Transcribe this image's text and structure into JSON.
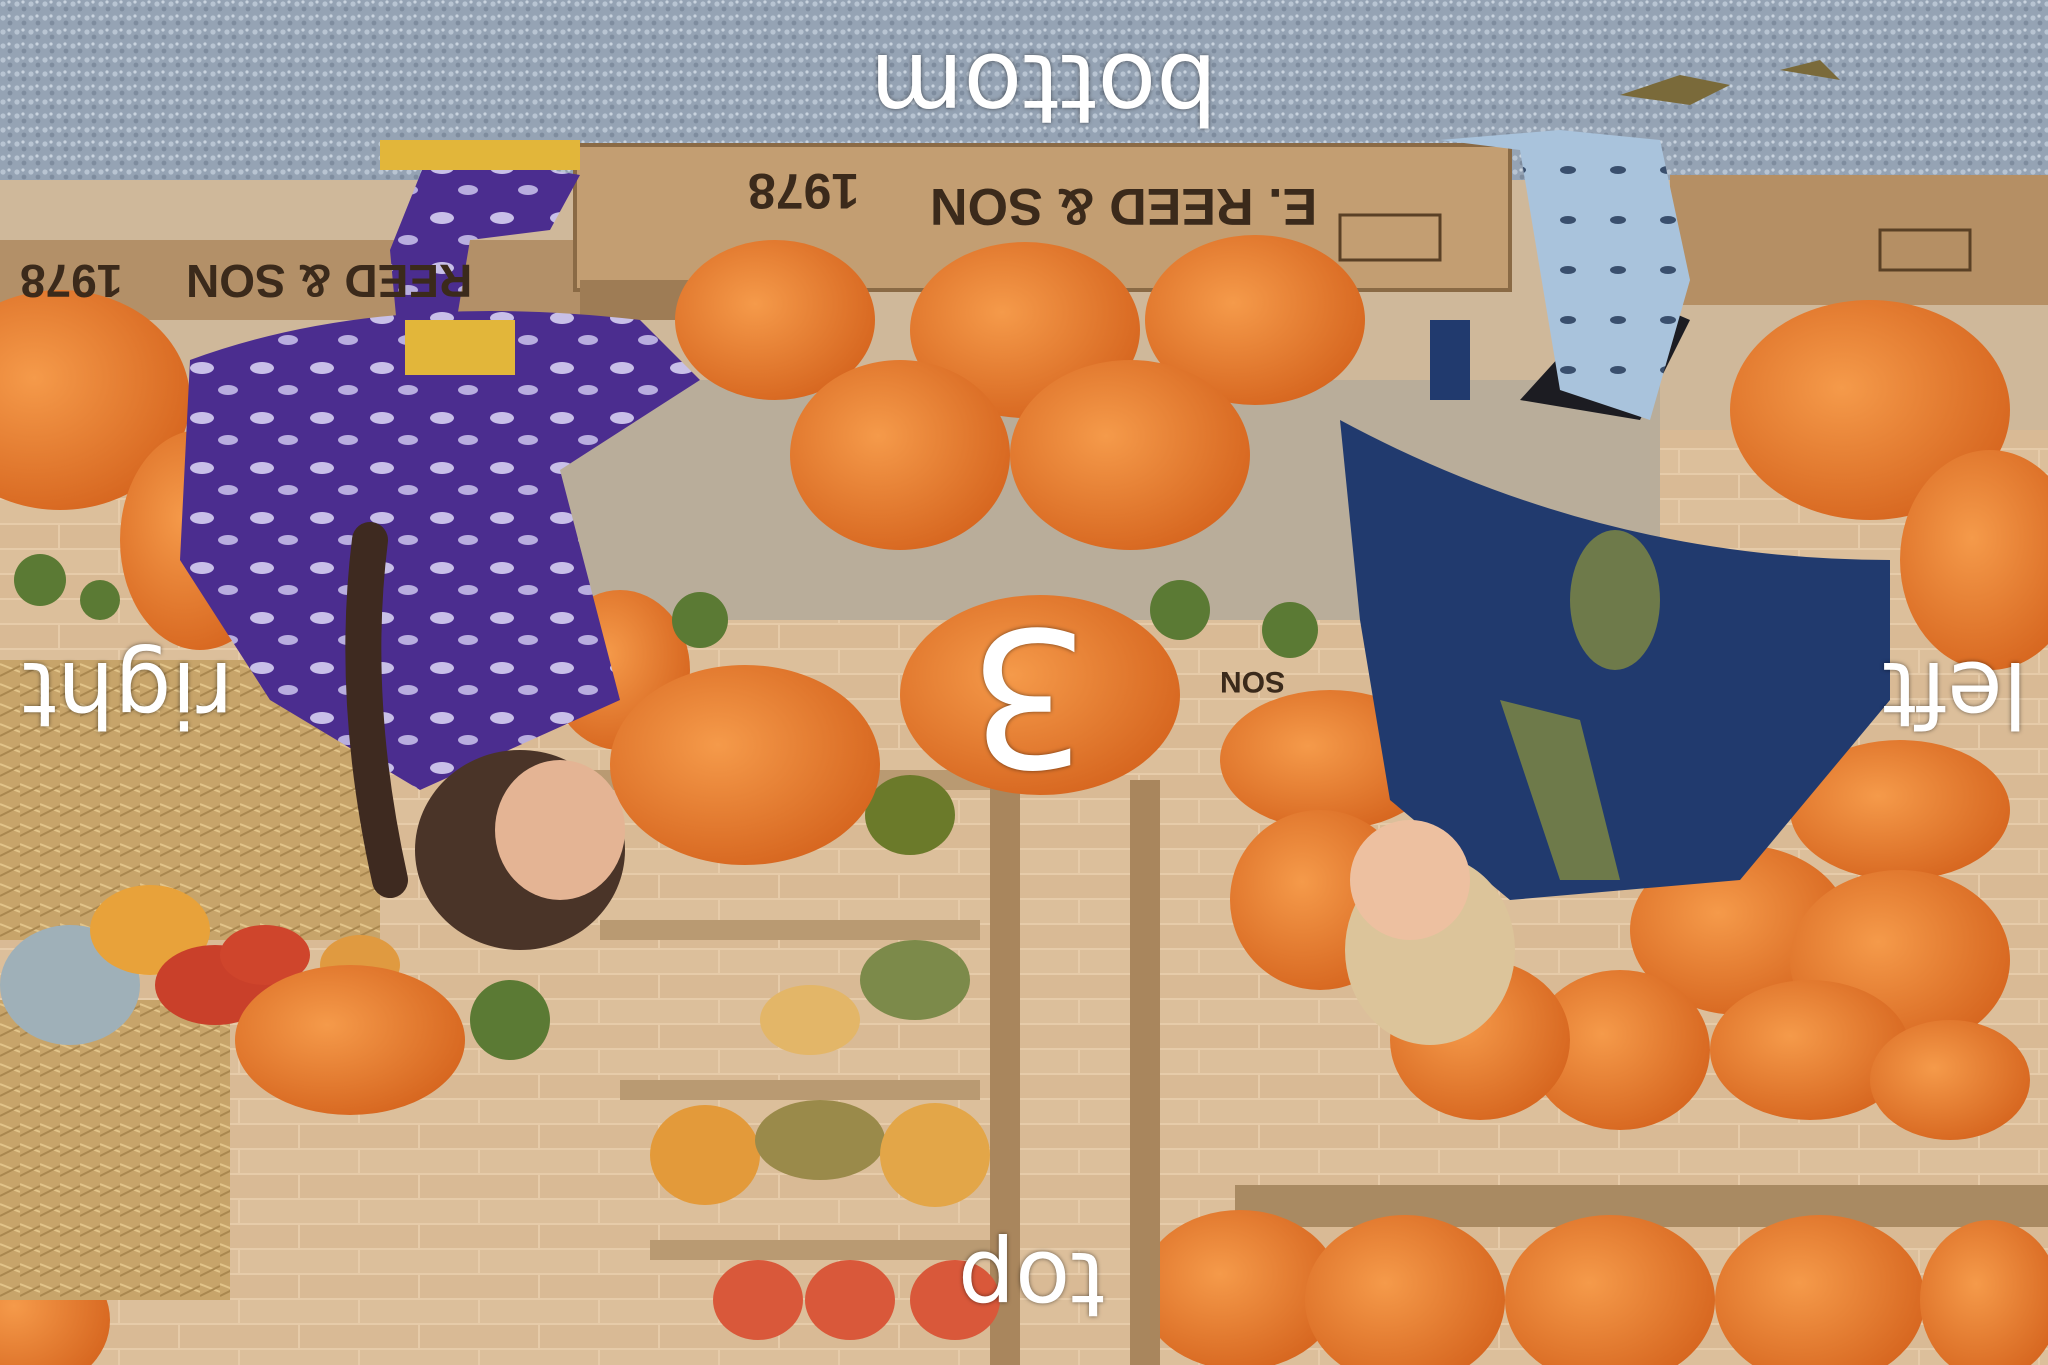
{
  "overlay": {
    "top_label": "bottom",
    "bottom_label": "top",
    "left_label": "right",
    "right_label": "left",
    "center_number": "3"
  },
  "crate_text": {
    "brand": "E. REED & SON",
    "year": "1978",
    "brand_partial": "REED & SON",
    "brand_fragment": "SON"
  },
  "colors": {
    "gravel": "#9aa7b6",
    "pumpkin": "#e2742a",
    "crate_wood": "#b08c63",
    "purple_coat": "#4a2a8c",
    "navy_coat": "#1f3566",
    "straw": "#c9a869",
    "brick": "#e0c3a0"
  }
}
